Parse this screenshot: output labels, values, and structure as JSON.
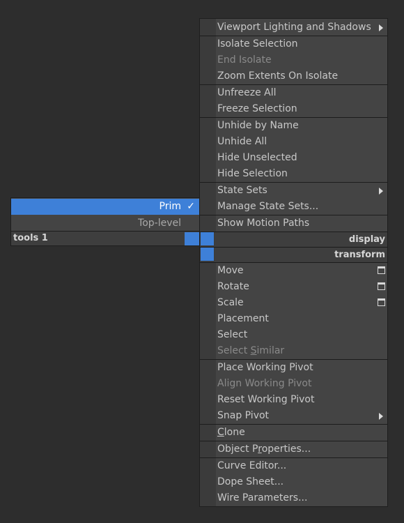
{
  "left_menu": {
    "prim": "Prim",
    "check": "✓",
    "top_level": "Top-level",
    "header": "tools 1"
  },
  "quad_menu": {
    "viewport_lighting": "Viewport Lighting and Shadows",
    "isolate_selection": "Isolate Selection",
    "end_isolate": "End Isolate",
    "zoom_extents_isolate": "Zoom Extents On Isolate",
    "unfreeze_all": "Unfreeze All",
    "freeze_selection": "Freeze Selection",
    "unhide_by_name": "Unhide by Name",
    "unhide_all": "Unhide All",
    "hide_unselected": "Hide Unselected",
    "hide_selection": "Hide Selection",
    "state_sets": "State Sets",
    "manage_state_sets": "Manage State Sets...",
    "show_motion_paths": "Show Motion Paths",
    "display_header": "display",
    "transform_header": "transform",
    "move": "Move",
    "rotate": "Rotate",
    "scale": "Scale",
    "placement": "Placement",
    "select": "Select",
    "select_similar_pre": "Select ",
    "select_similar_u": "S",
    "select_similar_post": "imilar",
    "place_working_pivot": "Place Working Pivot",
    "align_working_pivot": "Align Working Pivot",
    "reset_working_pivot": "Reset Working Pivot",
    "snap_pivot": "Snap Pivot",
    "clone_u": "C",
    "clone_post": "lone",
    "object_props_pre": "Object P",
    "object_props_u": "r",
    "object_props_post": "operties...",
    "curve_editor": "Curve Editor...",
    "dope_sheet": "Dope Sheet...",
    "wire_parameters": "Wire Parameters..."
  },
  "colors": {
    "background": "#2d2d2d",
    "menu_bg": "#444444",
    "highlight": "#3e80d8",
    "text": "#c8c8c8",
    "disabled_text": "#8a8a8a"
  }
}
